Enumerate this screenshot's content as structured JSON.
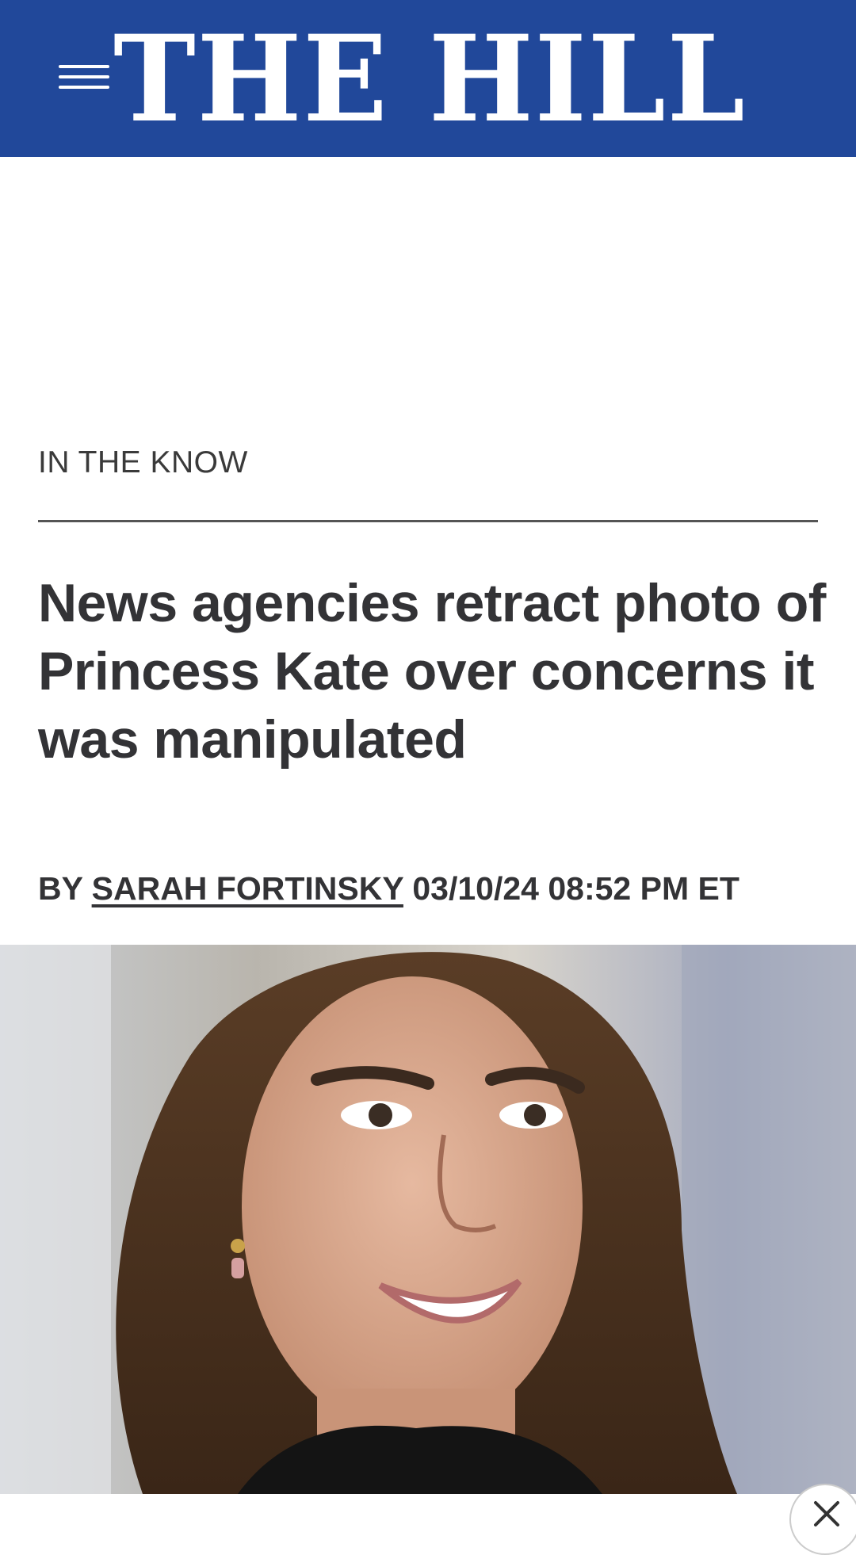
{
  "header": {
    "logo_text": "THE HILL",
    "menu_icon": "hamburger-menu-icon",
    "background_color": "#21489a"
  },
  "article": {
    "section_label": "IN THE KNOW",
    "headline": "News agencies retract photo of Princess Kate over concerns it was manipulated",
    "byline_prefix": "BY",
    "author": "SARAH FORTINSKY",
    "timestamp": "03/10/24 08:52 PM ET"
  },
  "ad_overlay": {
    "close_icon": "close-icon"
  }
}
